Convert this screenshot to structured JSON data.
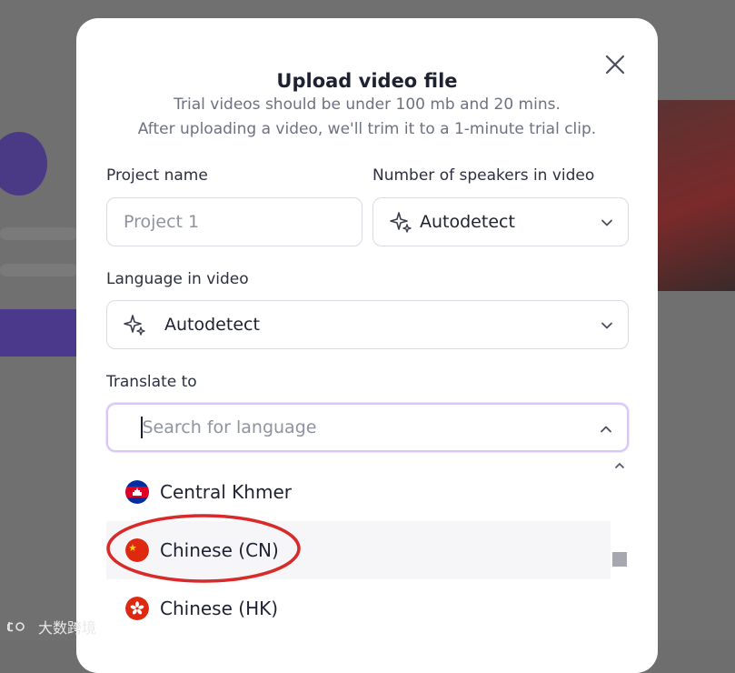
{
  "modal": {
    "title": "Upload video file",
    "subtitle_line1": "Trial videos should be under 100 mb and 20 mins.",
    "subtitle_line2": "After uploading a video, we'll trim it to a 1-minute trial clip."
  },
  "project": {
    "label": "Project name",
    "placeholder": "Project 1"
  },
  "speakers": {
    "label": "Number of speakers in video",
    "value": "Autodetect"
  },
  "language": {
    "label": "Language in video",
    "value": "Autodetect"
  },
  "translate": {
    "label": "Translate to",
    "placeholder": "Search for language"
  },
  "options": [
    {
      "name": "Central Khmer",
      "flag": "cambodia-flag"
    },
    {
      "name": "Chinese (CN)",
      "flag": "china-flag",
      "highlighted": true
    },
    {
      "name": "Chinese (HK)",
      "flag": "hong-kong-flag"
    }
  ],
  "watermark": {
    "text": "大数跨境"
  },
  "colors": {
    "annotation": "#d82a2a",
    "focus_border": "#d7c8f7",
    "text": "#1d2230",
    "muted": "#6b7280"
  }
}
